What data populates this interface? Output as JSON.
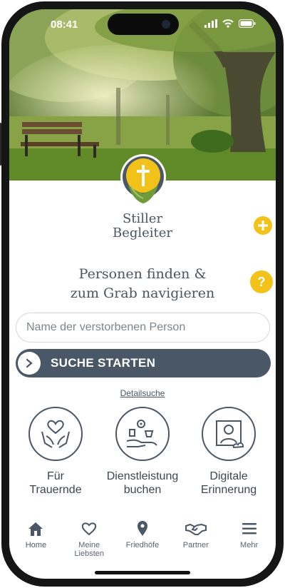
{
  "status_bar": {
    "time": "08:41"
  },
  "brand": {
    "line1": "Stiller",
    "line2": "Begleiter"
  },
  "headline": {
    "line1": "Personen finden &",
    "line2": "zum Grab navigieren"
  },
  "search": {
    "placeholder": "Name der verstorbenen Person"
  },
  "search_button": {
    "label": "SUCHE STARTEN"
  },
  "detail_link": "Detailsuche",
  "help_badge": "?",
  "features": [
    {
      "line1": "Für",
      "line2": "Trauernde",
      "icon": "heart-hands-icon"
    },
    {
      "line1": "Dienstleistung",
      "line2": "buchen",
      "icon": "service-hand-icon"
    },
    {
      "line1": "Digitale",
      "line2": "Erinnerung",
      "icon": "digital-memorial-icon"
    }
  ],
  "tabs": [
    {
      "label": "Home",
      "icon": "home-icon"
    },
    {
      "label": "Meine Liebsten",
      "icon": "heart-icon"
    },
    {
      "label": "Friedhöfe",
      "icon": "location-pin-icon"
    },
    {
      "label": "Partner",
      "icon": "handshake-icon"
    },
    {
      "label": "Mehr",
      "icon": "menu-icon"
    }
  ],
  "colors": {
    "accent_yellow": "#f3c21a",
    "primary_slate": "#4a5766",
    "text": "#4a5560"
  }
}
